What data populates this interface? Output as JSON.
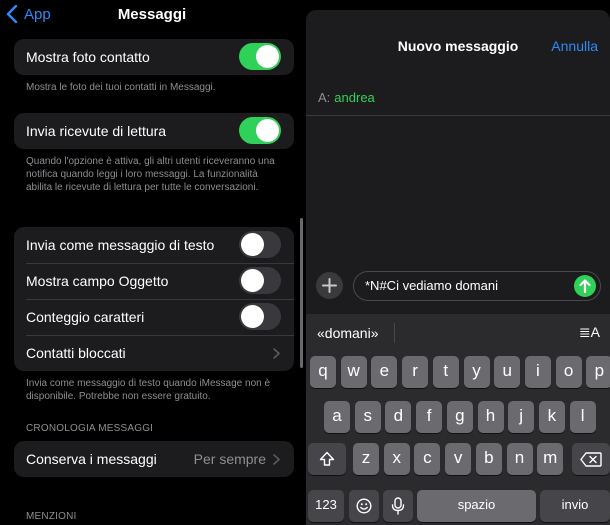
{
  "settings": {
    "back_label": "App",
    "title": "Messaggi",
    "rows": {
      "mostra_foto": "Mostra foto contatto",
      "ricevute": "Invia ricevute di lettura",
      "invia_testo": "Invia come messaggio di testo",
      "campo_oggetto": "Mostra campo Oggetto",
      "conteggio": "Conteggio caratteri",
      "bloccati": "Contatti bloccati",
      "conserva": "Conserva i messaggi",
      "conserva_value": "Per sempre"
    },
    "toggles": {
      "mostra_foto": true,
      "ricevute": true,
      "invia_testo": false,
      "campo_oggetto": false,
      "conteggio": false
    },
    "footers": {
      "mostra_foto": "Mostra le foto dei tuoi contatti in Messaggi.",
      "ricevute": "Quando l'opzione è attiva, gli altri utenti riceveranno una notifica quando leggi i loro messaggi. La funzionalità abilita le ricevute di lettura per tutte le conversazioni.",
      "invia_testo": "Invia come messaggio di testo quando iMessage non è disponibile. Potrebbe non essere gratuito."
    },
    "sections": {
      "cronologia": "CRONOLOGIA MESSAGGI",
      "menzioni": "MENZIONI"
    }
  },
  "compose": {
    "title": "Nuovo messaggio",
    "cancel_label": "Annulla",
    "to_label": "A:",
    "recipient": "andrea",
    "message_text": "*N#Ci vediamo domani"
  },
  "keyboard": {
    "suggestion": "«domani»",
    "format_label": "≣A",
    "row1": [
      "q",
      "w",
      "e",
      "r",
      "t",
      "y",
      "u",
      "i",
      "o",
      "p"
    ],
    "row2": [
      "a",
      "s",
      "d",
      "f",
      "g",
      "h",
      "j",
      "k",
      "l"
    ],
    "row3": [
      "z",
      "x",
      "c",
      "v",
      "b",
      "n",
      "m"
    ],
    "numbers_label": "123",
    "space_label": "spazio",
    "return_label": "invio"
  },
  "colors": {
    "accent_blue": "#2f8af7",
    "toggle_green": "#30d158",
    "cell_bg": "#1c1c1e",
    "key_bg": "#6b6b6f"
  },
  "icons": {
    "back": "chevron-left-icon",
    "row_chevron": "chevron-right-icon",
    "plus": "plus-icon",
    "send": "arrow-up-icon",
    "shift": "shift-icon",
    "delete": "delete-icon",
    "emoji": "emoji-icon",
    "mic": "microphone-icon"
  }
}
